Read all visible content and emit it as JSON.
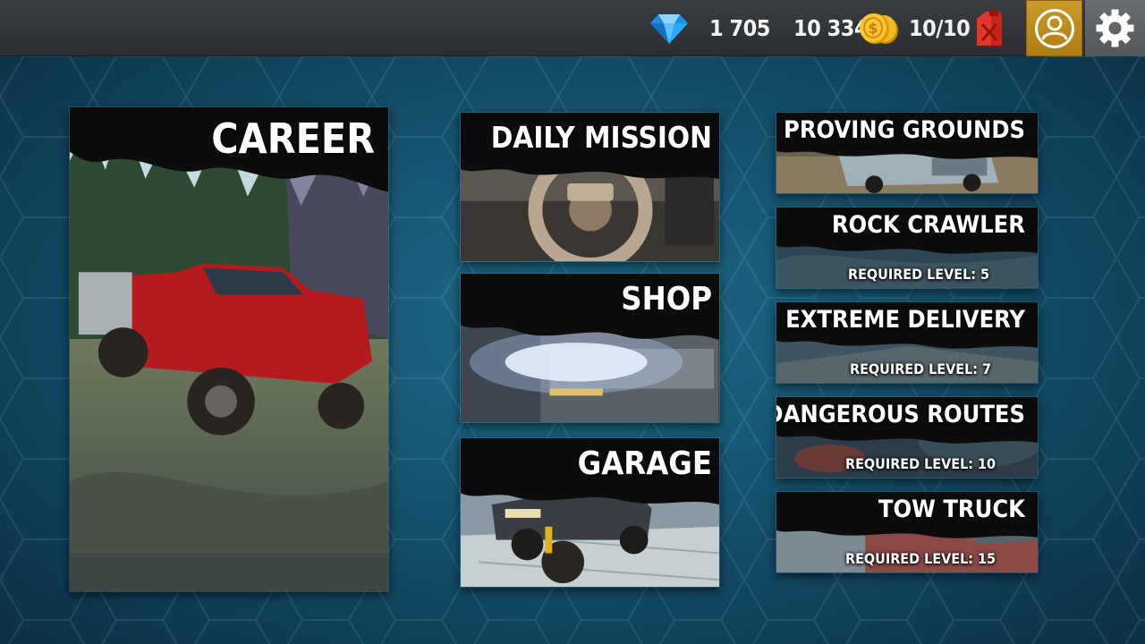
{
  "topbar": {
    "gems": "1 705",
    "money": "10 334",
    "fuel": "10/10",
    "icons": {
      "gems": "diamond-icon",
      "money": "coin-stack-icon",
      "fuel": "jerrycan-icon",
      "profile": "user-icon",
      "settings": "gear-icon"
    },
    "colors": {
      "profile_bg": "#c99a2a",
      "settings_bg": "#5f6367",
      "gem": "#2aa8ff",
      "coin": "#f2b51c",
      "fuel": "#d42a20"
    }
  },
  "modes": {
    "career": {
      "title": "CAREER"
    },
    "daily_mission": {
      "title": "DAILY MISSION"
    },
    "shop": {
      "title": "SHOP"
    },
    "garage": {
      "title": "GARAGE"
    }
  },
  "events": [
    {
      "title": "PROVING GROUNDS",
      "requirement": ""
    },
    {
      "title": "ROCK CRAWLER",
      "requirement": "REQUIRED LEVEL: 5"
    },
    {
      "title": "EXTREME DELIVERY",
      "requirement": "REQUIRED LEVEL: 7"
    },
    {
      "title": "DANGEROUS ROUTES",
      "requirement": "REQUIRED LEVEL: 10"
    },
    {
      "title": "TOW TRUCK",
      "requirement": "REQUIRED LEVEL: 15"
    }
  ]
}
